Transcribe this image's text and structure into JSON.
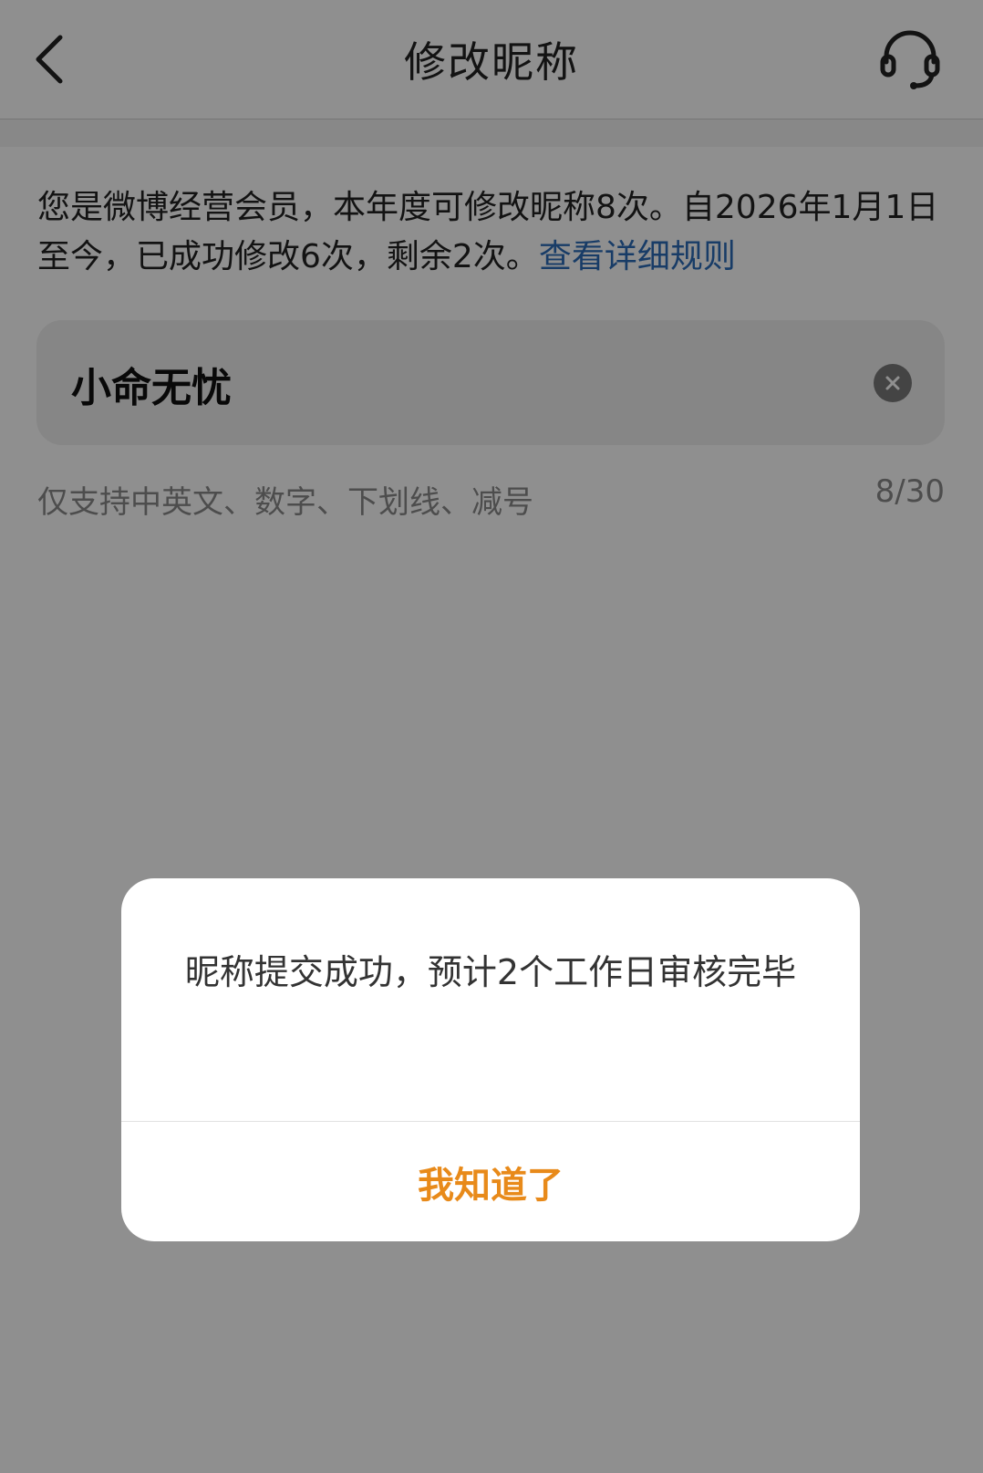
{
  "nav": {
    "title": "修改昵称"
  },
  "notice": {
    "text": "您是微博经营会员，本年度可修改昵称8次。自2026年1月1日至今，已成功修改6次，剩余2次。",
    "link_text": "查看详细规则"
  },
  "nickname": {
    "value": "小命无忧",
    "hint": "仅支持中英文、数字、下划线、减号",
    "counter": "8/30"
  },
  "dialog": {
    "message": "昵称提交成功，预计2个工作日审核完毕",
    "confirm_label": "我知道了"
  },
  "colors": {
    "link": "#2b6cb8",
    "accent": "#e88a1a",
    "overlay": "rgba(0,0,0,0.44)"
  },
  "icons": {
    "back": "chevron-left-icon",
    "support": "headset-icon",
    "clear": "clear-circle-icon"
  }
}
